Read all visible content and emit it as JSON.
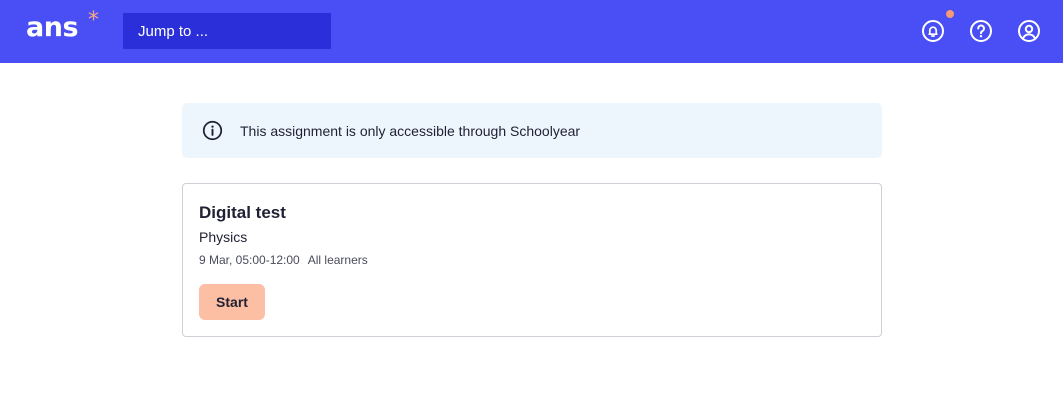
{
  "header": {
    "logo_text": "ans",
    "logo_mark": "*",
    "search": {
      "placeholder": "Jump to ..."
    },
    "icons": [
      "bell-icon",
      "help-icon",
      "user-icon"
    ],
    "has_notification": true
  },
  "banner": {
    "icon": "info-icon",
    "text": "This assignment is only accessible through Schoolyear"
  },
  "assignment": {
    "title": "Digital test",
    "subject": "Physics",
    "datetime": "9 Mar, 05:00-12:00",
    "audience": "All learners",
    "start_label": "Start"
  },
  "colors": {
    "header_bg": "#4a4ef5",
    "search_bg": "#2b2fd9",
    "accent": "#f49a74",
    "start_button": "#fdbfa3",
    "banner_bg": "#eef6fd"
  }
}
